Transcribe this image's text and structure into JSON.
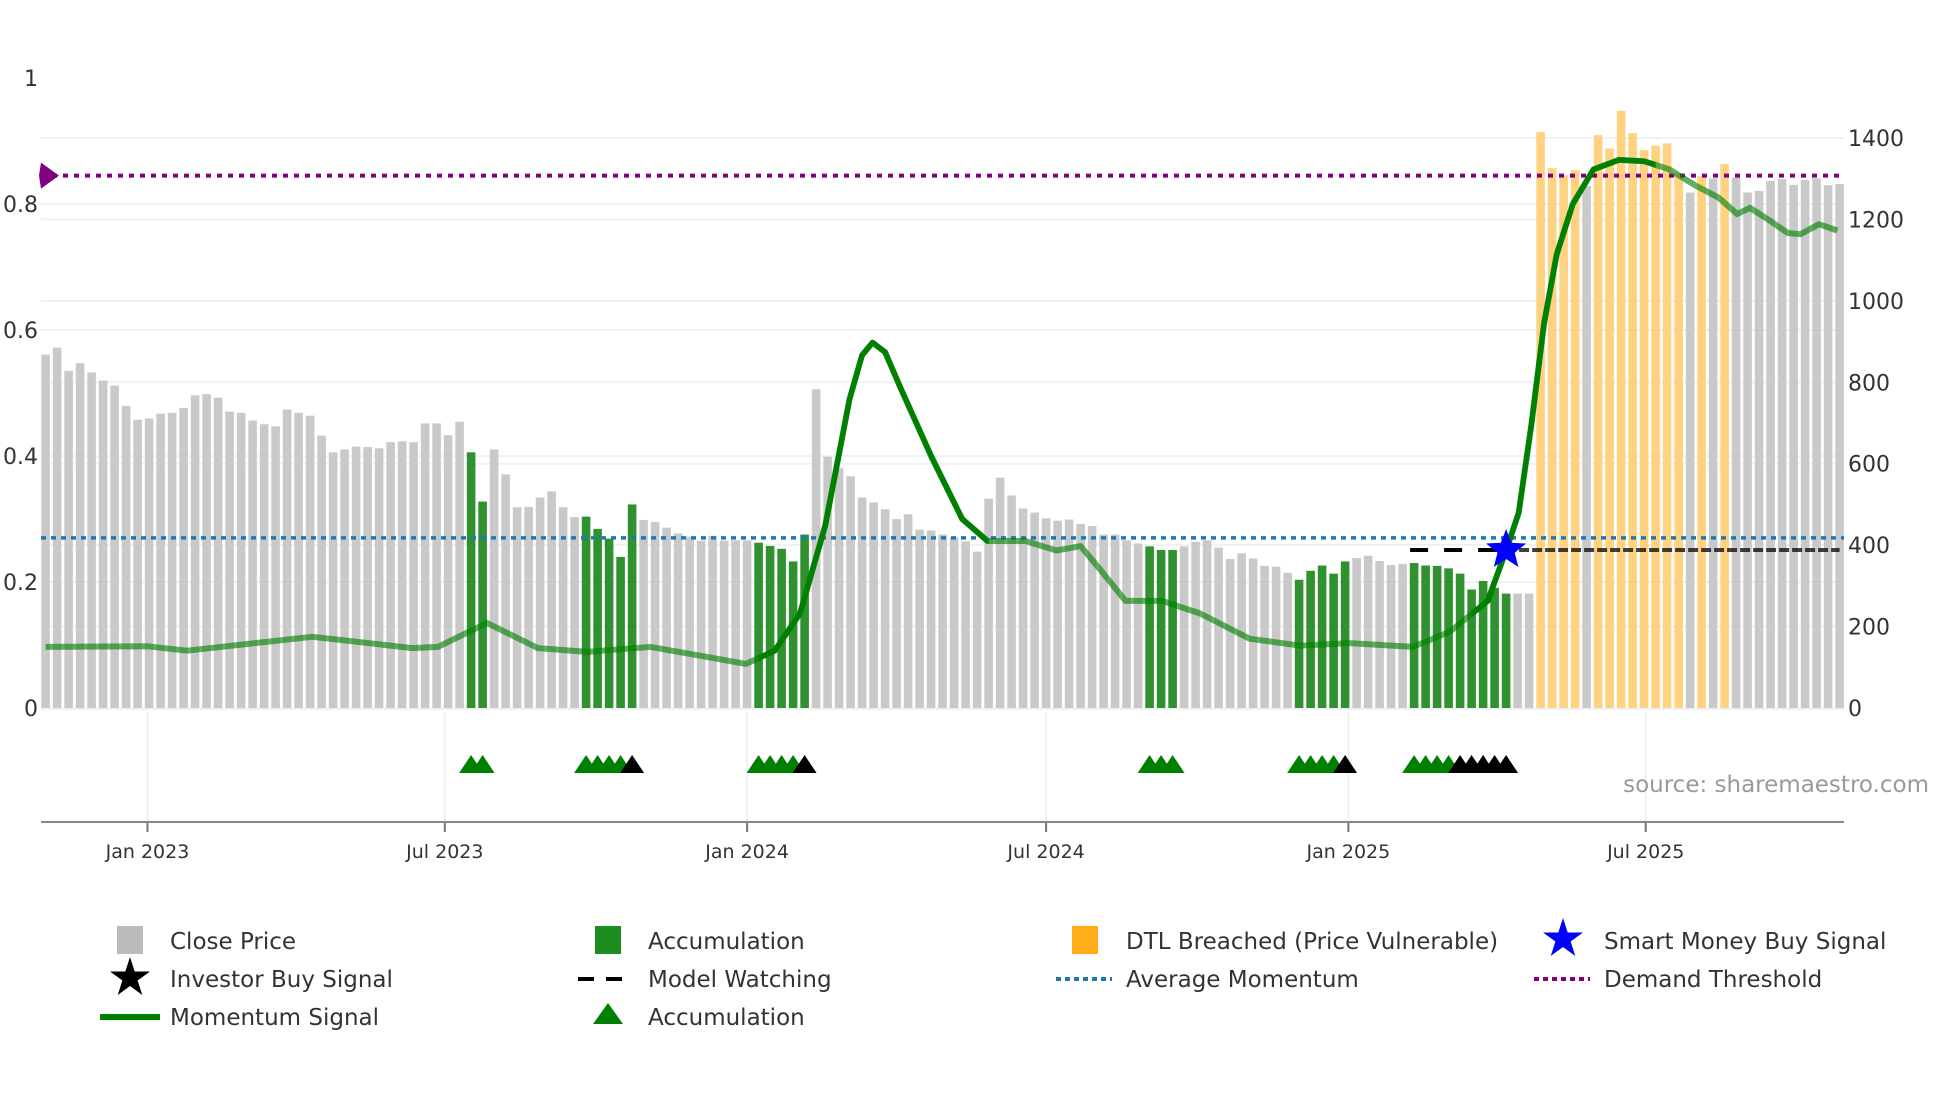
{
  "chart_data": {
    "type": "bar",
    "title": "",
    "start_date": "2022-10-31",
    "frequency": "weekly",
    "y_left": {
      "range": [
        0,
        1
      ],
      "ticks": [
        "0",
        "0.2",
        "0.4",
        "0.6",
        "0.8",
        "1"
      ],
      "tick_values": [
        0,
        0.2,
        0.4,
        0.6,
        0.8,
        1
      ]
    },
    "y_right": {
      "range": [
        0,
        1400
      ],
      "ticks": [
        "0",
        "200",
        "400",
        "600",
        "800",
        "1000",
        "1200",
        "1400"
      ],
      "tick_values": [
        0,
        200,
        400,
        600,
        800,
        1000,
        1200,
        1400
      ]
    },
    "x_ticks": [
      {
        "label": "Jan 2023",
        "date": "2023-01-01"
      },
      {
        "label": "Jul 2023",
        "date": "2023-07-01"
      },
      {
        "label": "Jan 2024",
        "date": "2024-01-01"
      },
      {
        "label": "Jul 2024",
        "date": "2024-07-01"
      },
      {
        "label": "Jan 2025",
        "date": "2025-01-01"
      },
      {
        "label": "Jul 2025",
        "date": "2025-07-01"
      }
    ],
    "close_price": [
      868,
      885,
      828,
      847,
      824,
      804,
      792,
      742,
      708,
      711,
      723,
      725,
      737,
      768,
      771,
      762,
      728,
      725,
      706,
      697,
      692,
      733,
      725,
      718,
      669,
      628,
      635,
      642,
      641,
      638,
      653,
      655,
      653,
      699,
      699,
      670,
      703,
      628,
      507,
      635,
      574,
      493,
      494,
      517,
      532,
      493,
      469,
      470,
      440,
      416,
      371,
      500,
      462,
      457,
      443,
      429,
      421,
      411,
      423,
      411,
      412,
      412,
      406,
      398,
      391,
      360,
      426,
      783,
      617,
      589,
      569,
      517,
      505,
      488,
      464,
      476,
      438,
      436,
      426,
      419,
      409,
      384,
      514,
      566,
      522,
      490,
      480,
      466,
      460,
      463,
      452,
      447,
      426,
      426,
      412,
      404,
      397,
      388,
      388,
      397,
      408,
      412,
      394,
      366,
      380,
      367,
      349,
      347,
      332,
      315,
      337,
      350,
      330,
      360,
      368,
      374,
      361,
      351,
      354,
      356,
      350,
      349,
      343,
      330,
      291,
      312,
      295,
      281,
      281,
      281,
      1415,
      1326,
      1309,
      1321,
      1282,
      1407,
      1374,
      1467,
      1412,
      1371,
      1381,
      1387,
      1313,
      1266,
      1307,
      1301,
      1336,
      1303,
      1266,
      1270,
      1295,
      1299,
      1285,
      1297,
      1301,
      1284,
      1287
    ],
    "accumulation_indices": [
      37,
      38,
      47,
      48,
      49,
      50,
      51,
      62,
      63,
      64,
      65,
      66,
      96,
      97,
      98,
      109,
      110,
      111,
      112,
      113,
      119,
      120,
      121,
      122,
      123,
      124,
      125,
      126,
      127
    ],
    "dtl_breached_indices": [
      130,
      131,
      132,
      133,
      135,
      136,
      137,
      138,
      139,
      140,
      141,
      142,
      144,
      146
    ],
    "accumulation_triangle_indices": [
      37,
      38,
      47,
      48,
      49,
      50,
      62,
      63,
      64,
      65,
      96,
      97,
      98,
      109,
      110,
      111,
      112,
      119,
      120,
      121,
      122
    ],
    "black_triangle_indices": [
      51,
      66,
      113,
      123,
      124,
      125,
      126,
      127
    ],
    "momentum": {
      "week": [
        0,
        8.9,
        12.3,
        23.2,
        31.9,
        34.1,
        38.4,
        42.8,
        47.1,
        52.6,
        56.9,
        60.9,
        63.4,
        65.6,
        67.8,
        69.9,
        71.0,
        71.9,
        73.0,
        74.3,
        77.0,
        79.7,
        81.9,
        85.2,
        87.9,
        90.0,
        91.7,
        93.9,
        97.1,
        100.4,
        104.7,
        109.1,
        113.4,
        118.9,
        122.1,
        125.4,
        127.0,
        128.1,
        129.2,
        130.3,
        131.4,
        132.8,
        134.6,
        136.8,
        139.0,
        141.2,
        143.4,
        145.5,
        147.1,
        148.2,
        149.9,
        151.5,
        152.6,
        154.2,
        155.8
      ],
      "value": [
        0.097,
        0.098,
        0.091,
        0.113,
        0.095,
        0.097,
        0.135,
        0.095,
        0.089,
        0.097,
        0.083,
        0.07,
        0.091,
        0.15,
        0.29,
        0.49,
        0.56,
        0.58,
        0.565,
        0.51,
        0.4,
        0.3,
        0.265,
        0.265,
        0.25,
        0.257,
        0.22,
        0.17,
        0.17,
        0.15,
        0.11,
        0.099,
        0.103,
        0.097,
        0.121,
        0.17,
        0.25,
        0.31,
        0.45,
        0.61,
        0.72,
        0.8,
        0.855,
        0.87,
        0.868,
        0.855,
        0.83,
        0.81,
        0.784,
        0.794,
        0.774,
        0.754,
        0.752,
        0.768,
        0.758
      ]
    },
    "average_momentum": 0.27,
    "demand_threshold": 0.845,
    "model_watching": {
      "start_index": 119,
      "end_index": 156,
      "price": 388
    },
    "smart_money_buy_signal": {
      "index": 127,
      "price": 388
    },
    "colors": {
      "close": "#c9c9c9",
      "accumulation": "#2f922f",
      "dtl": "#ffd282",
      "momentum": "#008000",
      "avg_momentum": "#1f77b4",
      "threshold": "#800080",
      "star": "#0000ff"
    }
  },
  "source": "source: sharemaestro.com",
  "legend": {
    "items": [
      {
        "label": "Close Price"
      },
      {
        "label": "Accumulation"
      },
      {
        "label": "DTL Breached (Price Vulnerable)"
      },
      {
        "label": "Smart Money Buy Signal"
      },
      {
        "label": "Investor Buy Signal"
      },
      {
        "label": "Model Watching"
      },
      {
        "label": "Average Momentum"
      },
      {
        "label": "Demand Threshold"
      },
      {
        "label": "Momentum Signal"
      },
      {
        "label": "Accumulation"
      }
    ]
  }
}
